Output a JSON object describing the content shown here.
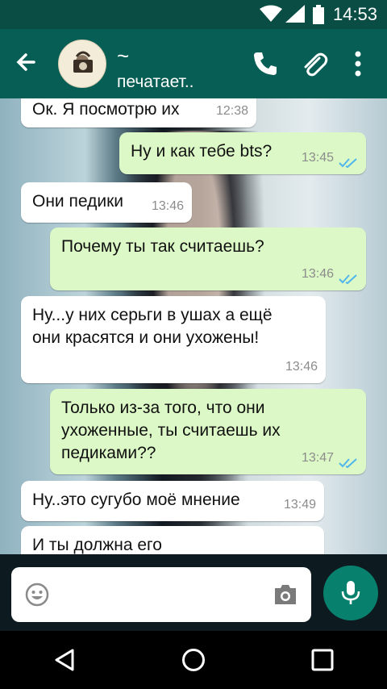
{
  "status_bar": {
    "time": "14:53"
  },
  "header": {
    "contact_name": "~",
    "status": "печатает.."
  },
  "messages": [
    {
      "direction": "in",
      "text": "Ок. Я посмотрю их",
      "time": "12:38"
    },
    {
      "direction": "out",
      "text": "Ну и как тебе bts?",
      "time": "13:45"
    },
    {
      "direction": "in",
      "text": "Они педики",
      "time": "13:46"
    },
    {
      "direction": "out",
      "text": "Почему ты так считаешь?",
      "time": "13:46"
    },
    {
      "direction": "in",
      "text": "Ну...у них серьги в ушах а ещё они красятся и они ухожены!",
      "time": "13:46"
    },
    {
      "direction": "out",
      "text": "Только из-за того, что они ухоженные, ты считаешь их педиками??",
      "time": "13:47"
    },
    {
      "direction": "in",
      "text": "Ну..это сугубо моё мнение",
      "time": "13:49"
    },
    {
      "direction": "in",
      "text": "И ты должна его",
      "time": ""
    }
  ],
  "icons": {
    "back": "arrow-left-icon",
    "call": "phone-icon",
    "attach": "paperclip-icon",
    "more": "more-vertical-icon",
    "emoji": "smiley-icon",
    "camera": "camera-icon",
    "mic": "microphone-icon"
  },
  "colors": {
    "header": "#075e54",
    "status_bar": "#0a4d45",
    "outgoing": "#dcf8c6",
    "incoming": "#ffffff",
    "accent": "#08806e",
    "tick": "#4fb6ec"
  }
}
